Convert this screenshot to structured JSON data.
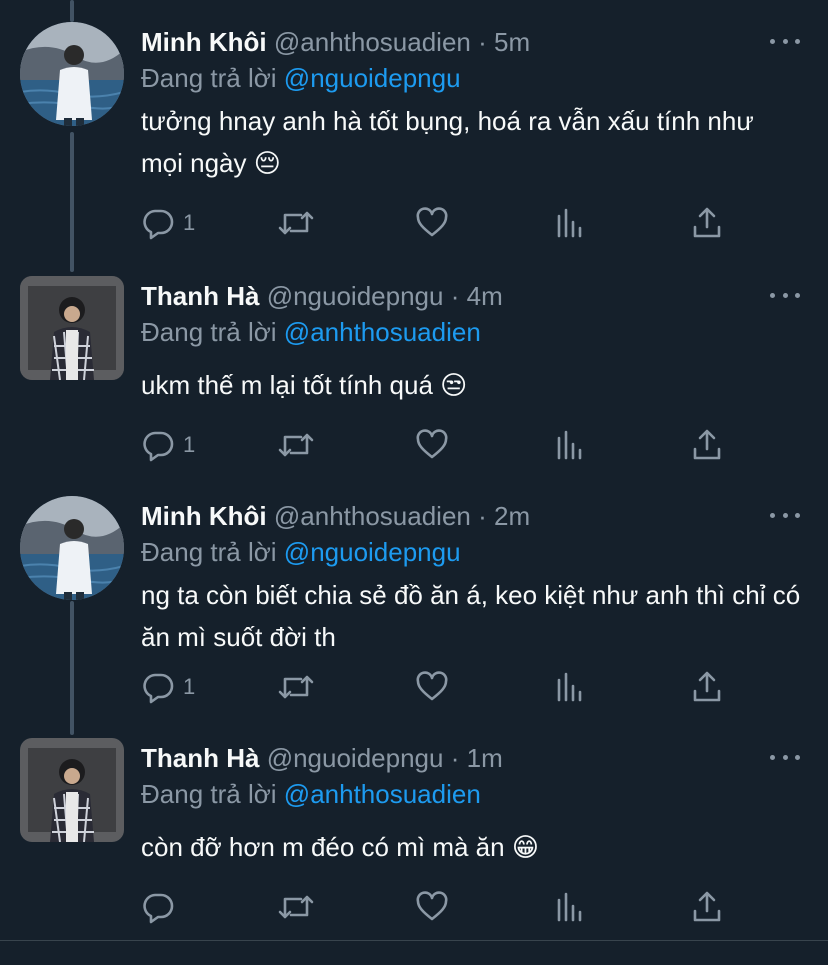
{
  "replying_label": "Đang trả lời",
  "tweets": [
    {
      "name": "Minh Khôi",
      "handle": "@anhthosuadien",
      "separator": "·",
      "time": "5m",
      "reply_to": "@nguoidepngu",
      "text": "tưởng hnay anh hà tốt bụng, hoá ra vẫn xấu tính như mọi ngày 😔",
      "reply_count": "1"
    },
    {
      "name": "Thanh Hà",
      "handle": "@nguoidepngu",
      "separator": "·",
      "time": "4m",
      "reply_to": "@anhthosuadien",
      "text": "ukm thế m lại tốt tính quá 😒",
      "reply_count": "1"
    },
    {
      "name": "Minh Khôi",
      "handle": "@anhthosuadien",
      "separator": "·",
      "time": "2m",
      "reply_to": "@nguoidepngu",
      "text": "ng ta còn biết chia sẻ đồ ăn á, keo kiệt như anh thì chỉ có ăn mì suốt đời th",
      "reply_count": "1"
    },
    {
      "name": "Thanh Hà",
      "handle": "@nguoidepngu",
      "separator": "·",
      "time": "1m",
      "reply_to": "@anhthosuadien",
      "text": "còn đỡ hơn m đéo có mì mà ăn 😁",
      "reply_count": ""
    }
  ],
  "icons": {
    "reply": "speech-bubble-icon",
    "retweet": "retweet-arrows-icon",
    "like": "heart-outline-icon",
    "views": "bar-chart-icon",
    "share": "upload-arrow-icon",
    "more": "three-dots-icon"
  },
  "colors": {
    "background": "#15202b",
    "text": "#f7f9f9",
    "muted": "#8b98a5",
    "link": "#1d9bf0",
    "thread_line": "#425364"
  }
}
